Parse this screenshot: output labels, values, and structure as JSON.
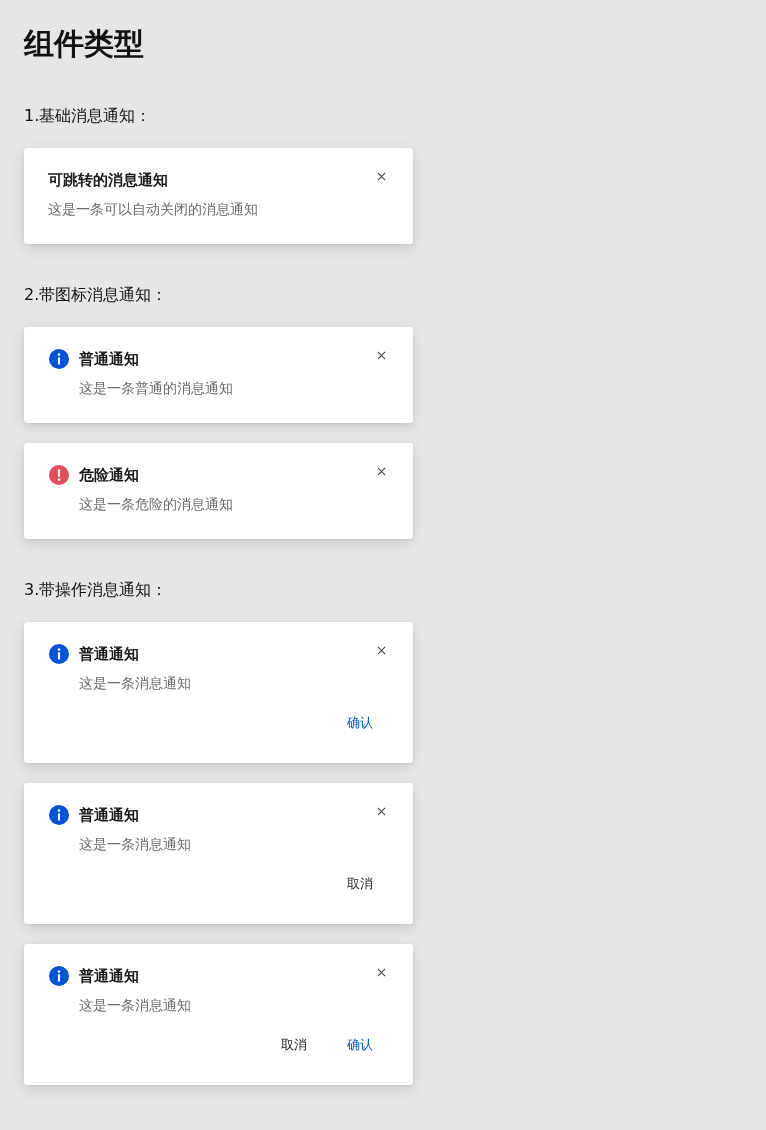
{
  "page_title": "组件类型",
  "sections": [
    {
      "heading": "1.基础消息通知：",
      "notifications": [
        {
          "kind": "plain",
          "title": "可跳转的消息通知",
          "message": "这是一条可以自动关闭的消息通知"
        }
      ]
    },
    {
      "heading": "2.带图标消息通知：",
      "notifications": [
        {
          "kind": "info",
          "title": "普通通知",
          "message": "这是一条普通的消息通知"
        },
        {
          "kind": "danger",
          "title": "危险通知",
          "message": "这是一条危险的消息通知"
        }
      ]
    },
    {
      "heading": "3.带操作消息通知：",
      "notifications": [
        {
          "kind": "info",
          "title": "普通通知",
          "message": "这是一条消息通知",
          "actions": [
            {
              "kind": "confirm",
              "label": "确认"
            }
          ]
        },
        {
          "kind": "info",
          "title": "普通通知",
          "message": "这是一条消息通知",
          "actions": [
            {
              "kind": "cancel",
              "label": "取消"
            }
          ]
        },
        {
          "kind": "info",
          "title": "普通通知",
          "message": "这是一条消息通知",
          "actions": [
            {
              "kind": "cancel",
              "label": "取消"
            },
            {
              "kind": "confirm",
              "label": "确认"
            }
          ]
        }
      ]
    }
  ]
}
